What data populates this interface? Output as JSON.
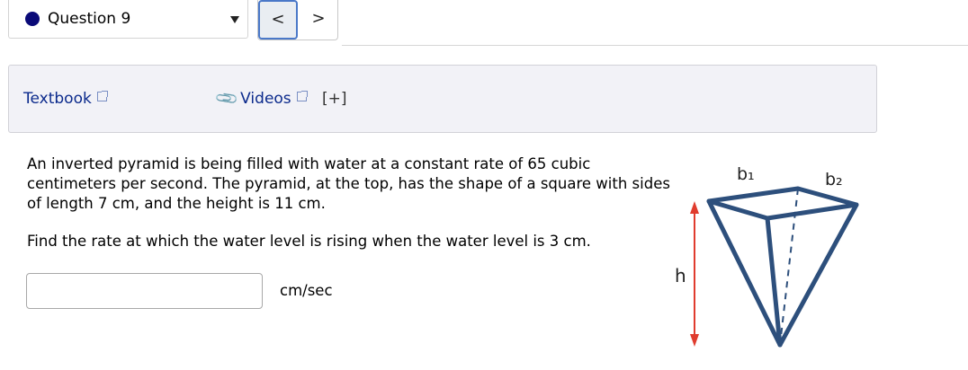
{
  "question_nav": {
    "label": "Question 9",
    "prev_symbol": "<",
    "next_symbol": ">"
  },
  "resources": {
    "textbook_label": "Textbook",
    "videos_label": "Videos",
    "expand_label": "[+]"
  },
  "question": {
    "paragraph1": "An inverted pyramid is being filled with water at a constant rate of 65 cubic centimeters per second. The pyramid, at the top, has the shape of a square with sides of length 7 cm, and the height is 11 cm.",
    "paragraph2": "Find the rate at which the water level is rising when the water level is 3 cm."
  },
  "answer": {
    "value": "",
    "unit": "cm/sec"
  },
  "figure": {
    "label_b1": "b₁",
    "label_b2": "b₂",
    "label_h": "h",
    "colors": {
      "edges": "#2d4f7c",
      "height_arrow": "#e03c2e"
    }
  }
}
